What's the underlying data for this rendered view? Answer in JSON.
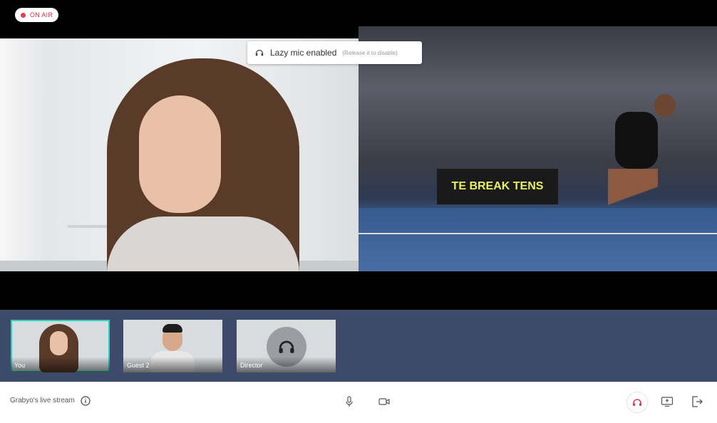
{
  "stage": {
    "on_air_label": "ON AIR",
    "toast": {
      "title": "Lazy mic enabled",
      "hint": "(Release it to disable)"
    },
    "banner_text": "TE BREAK TENS"
  },
  "participants": [
    {
      "label": "You",
      "active": true
    },
    {
      "label": "Guest 2",
      "active": false
    },
    {
      "label": "Director",
      "active": false
    }
  ],
  "bottombar": {
    "stream_name": "Grabyo's live stream"
  },
  "colors": {
    "accent_active": "#2bd1b8",
    "on_air_red": "#e23a50",
    "strip_bg": "#3e4a6a"
  },
  "icons": {
    "info": "info-icon",
    "mic": "microphone-icon",
    "camera": "camera-icon",
    "headset": "headset-icon",
    "screen": "screen-share-icon",
    "exit": "exit-icon"
  }
}
